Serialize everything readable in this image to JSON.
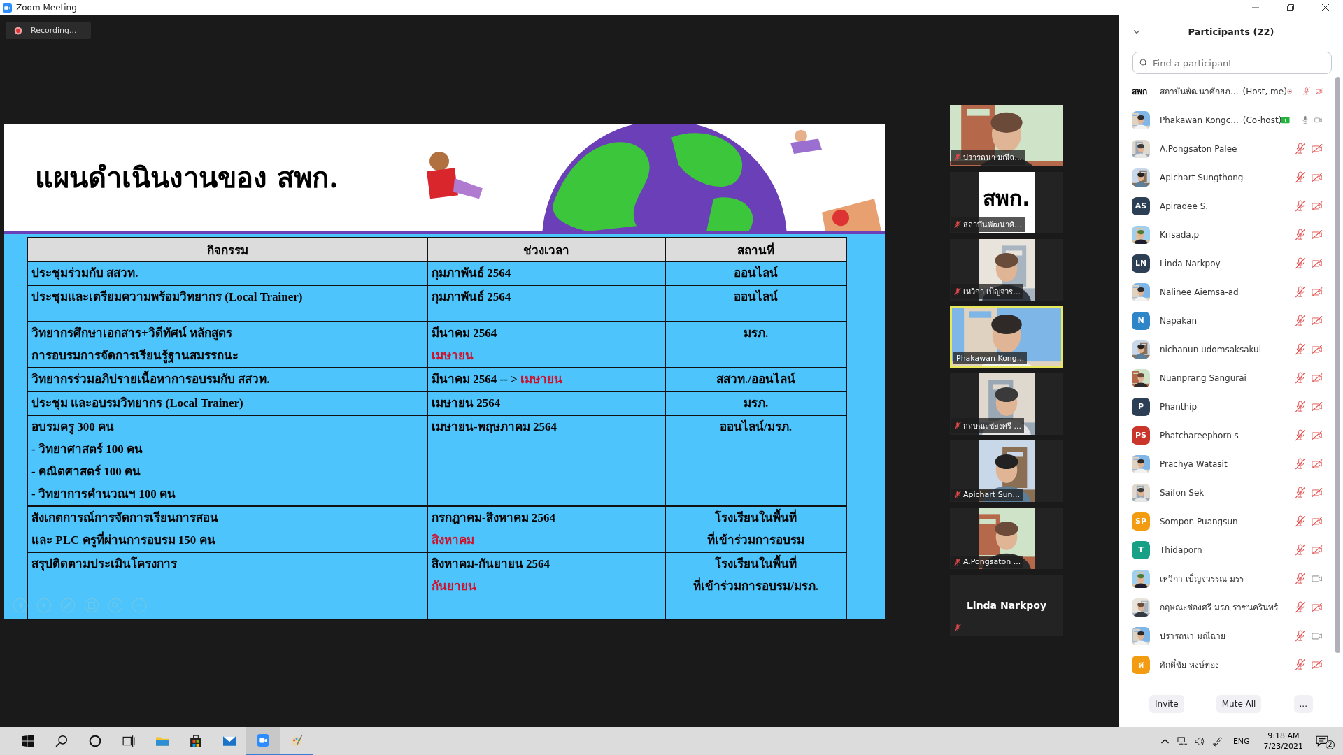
{
  "window": {
    "title": "Zoom Meeting"
  },
  "recording": {
    "label": "Recording..."
  },
  "slide": {
    "title": "แผนดำเนินงานของ สพก.",
    "table": {
      "columns": [
        "กิจกรรม",
        "ช่วงเวลา",
        "สถานที่"
      ],
      "rows": [
        {
          "cells": [
            [
              [
                {
                  "text": "ประชุมร่วมกับ สสวท.",
                  "highlight": false
                }
              ]
            ],
            [
              [
                {
                  "text": "กุมภาพันธ์ 2564",
                  "highlight": false
                }
              ]
            ],
            [
              [
                {
                  "text": "ออนไลน์",
                  "highlight": false
                }
              ]
            ]
          ]
        },
        {
          "cells": [
            [
              [
                {
                  "text": "ประชุมและเตรียมความพร้อมวิทยากร (Local Trainer)",
                  "highlight": false
                }
              ]
            ],
            [
              [
                {
                  "text": "กุมภาพันธ์ 2564",
                  "highlight": false
                }
              ]
            ],
            [
              [
                {
                  "text": "ออนไลน์",
                  "highlight": false
                }
              ]
            ]
          ]
        },
        {
          "cells": [
            [
              [
                {
                  "text": "วิทยากรศึกษาเอกสาร+วิดีทัศน์ หลักสูตร",
                  "highlight": false
                }
              ],
              [
                {
                  "text": "การอบรมการจัดการเรียนรู้ฐานสมรรถนะ",
                  "highlight": false
                }
              ]
            ],
            [
              [
                {
                  "text": "มีนาคม 2564",
                  "highlight": false
                }
              ],
              [
                {
                  "text": " เมษายน",
                  "highlight": true
                }
              ]
            ],
            [
              [
                {
                  "text": "มรภ.",
                  "highlight": false
                }
              ]
            ]
          ]
        },
        {
          "cells": [
            [
              [
                {
                  "text": "วิทยากรร่วมอภิปรายเนื้อหาการอบรมกับ สสวท.",
                  "highlight": false
                }
              ]
            ],
            [
              [
                {
                  "text": "มีนาคม 2564  -- > ",
                  "highlight": false
                },
                {
                  "text": "เมษายน",
                  "highlight": true
                }
              ]
            ],
            [
              [
                {
                  "text": "สสวท./ออนไลน์",
                  "highlight": false
                }
              ]
            ]
          ]
        },
        {
          "cells": [
            [
              [
                {
                  "text": "ประชุม และอบรมวิทยากร (Local Trainer)",
                  "highlight": false
                }
              ]
            ],
            [
              [
                {
                  "text": "เมษายน 2564",
                  "highlight": false
                }
              ]
            ],
            [
              [
                {
                  "text": "มรภ.",
                  "highlight": false
                }
              ]
            ]
          ]
        },
        {
          "cells": [
            [
              [
                {
                  "text": "อบรมครู 300 คน",
                  "highlight": false
                }
              ],
              [
                {
                  "text": "- วิทยาศาสตร์ 100 คน",
                  "highlight": false
                }
              ],
              [
                {
                  "text": "- คณิตศาสตร์ 100 คน",
                  "highlight": false
                }
              ],
              [
                {
                  "text": "- วิทยาการคำนวณฯ 100 คน",
                  "highlight": false
                }
              ]
            ],
            [
              [
                {
                  "text": "เมษายน-พฤษภาคม 2564",
                  "highlight": false
                }
              ]
            ],
            [
              [
                {
                  "text": "ออนไลน์/มรภ.",
                  "highlight": false
                }
              ]
            ]
          ]
        },
        {
          "cells": [
            [
              [
                {
                  "text": "สังเกตการณ์การจัดการเรียนการสอน",
                  "highlight": false
                }
              ],
              [
                {
                  "text": "และ PLC ครูที่ผ่านการอบรม 150 คน",
                  "highlight": false
                }
              ]
            ],
            [
              [
                {
                  "text": "กรกฎาคม-สิงหาคม 2564",
                  "highlight": false
                }
              ],
              [
                {
                  "text": "สิงหาคม",
                  "highlight": true
                }
              ]
            ],
            [
              [
                {
                  "text": "โรงเรียนในพื้นที่",
                  "highlight": false
                }
              ],
              [
                {
                  "text": "ที่เข้าร่วมการอบรม",
                  "highlight": false
                }
              ]
            ]
          ]
        },
        {
          "cells": [
            [
              [
                {
                  "text": "สรุปติดตามประเมินโครงการ",
                  "highlight": false
                }
              ]
            ],
            [
              [
                {
                  "text": "สิงหาคม-กันยายน 2564",
                  "highlight": false
                }
              ],
              [
                {
                  "text": "กันยายน",
                  "highlight": true
                }
              ]
            ],
            [
              [
                {
                  "text": "โรงเรียนในพื้นที่",
                  "highlight": false
                }
              ],
              [
                {
                  "text": "ที่เข้าร่วมการอบรม/มรภ.",
                  "highlight": false
                }
              ]
            ]
          ]
        }
      ]
    }
  },
  "thumbnails": [
    {
      "kind": "video",
      "full_frame": true,
      "label": "ปรารถนา มณีฉ...",
      "mic_muted": true,
      "speaking": false
    },
    {
      "kind": "logo",
      "full_frame": false,
      "logo": "สพก.",
      "label": "สถาบันพัฒนาศั...",
      "mic_muted": true,
      "speaking": false
    },
    {
      "kind": "video",
      "full_frame": false,
      "label": "เหวิกา เบ็ญจวร...",
      "mic_muted": true,
      "speaking": false
    },
    {
      "kind": "video",
      "full_frame": true,
      "label": "Phakawan Kong...",
      "mic_muted": false,
      "speaking": true
    },
    {
      "kind": "video",
      "full_frame": false,
      "label": "กฤษณะช่องศรี ...",
      "mic_muted": true,
      "speaking": false
    },
    {
      "kind": "video",
      "full_frame": false,
      "label": "Apichart Sun...",
      "mic_muted": true,
      "speaking": false
    },
    {
      "kind": "video",
      "full_frame": false,
      "label": "A.Pongsaton ...",
      "mic_muted": true,
      "speaking": false
    },
    {
      "kind": "name",
      "label": "Linda Narkpoy",
      "mic_muted": true,
      "speaking": false
    }
  ],
  "participants_panel": {
    "title": "Participants (22)",
    "search": {
      "placeholder": "Find a participant"
    },
    "participants": [
      {
        "name": "สถาบันพัฒนาศักยภ...",
        "role": "(Host, me)",
        "avatar": {
          "kind": "logo",
          "text": "สพก"
        },
        "recording": true,
        "sharing": false,
        "mic_muted": true,
        "video_off": true
      },
      {
        "name": "Phakawan Kongc...",
        "role": "(Co-host)",
        "recording": false,
        "sharing": true,
        "mic_muted": false,
        "video_off": false
      },
      {
        "name": "A.Pongsaton Palee",
        "recording": false,
        "sharing": false,
        "mic_muted": true,
        "video_off": true
      },
      {
        "name": "Apichart Sungthong",
        "recording": false,
        "sharing": false,
        "mic_muted": true,
        "video_off": true
      },
      {
        "name": "Apiradee S.",
        "avatar": {
          "kind": "initials",
          "text": "AS",
          "color": "#2d3f55"
        },
        "recording": false,
        "sharing": false,
        "mic_muted": true,
        "video_off": true
      },
      {
        "name": "Krisada.p",
        "recording": false,
        "sharing": false,
        "mic_muted": true,
        "video_off": true
      },
      {
        "name": "Linda Narkpoy",
        "avatar": {
          "kind": "initials",
          "text": "LN",
          "color": "#2d3f55"
        },
        "recording": false,
        "sharing": false,
        "mic_muted": true,
        "video_off": true
      },
      {
        "name": "Nalinee Aiemsa-ad",
        "recording": false,
        "sharing": false,
        "mic_muted": true,
        "video_off": true
      },
      {
        "name": "Napakan",
        "avatar": {
          "kind": "initials",
          "text": "N",
          "color": "#2e86c8"
        },
        "recording": false,
        "sharing": false,
        "mic_muted": true,
        "video_off": true
      },
      {
        "name": "nichanun udomsaksakul",
        "recording": false,
        "sharing": false,
        "mic_muted": true,
        "video_off": true
      },
      {
        "name": "Nuanprang Sangurai",
        "recording": false,
        "sharing": false,
        "mic_muted": true,
        "video_off": true
      },
      {
        "name": "Phanthip",
        "avatar": {
          "kind": "initials",
          "text": "P",
          "color": "#2d3f55"
        },
        "recording": false,
        "sharing": false,
        "mic_muted": true,
        "video_off": true
      },
      {
        "name": "Phatchareephorn s",
        "avatar": {
          "kind": "initials",
          "text": "PS",
          "color": "#c9352b"
        },
        "recording": false,
        "sharing": false,
        "mic_muted": true,
        "video_off": true
      },
      {
        "name": "Prachya Watasit",
        "recording": false,
        "sharing": false,
        "mic_muted": true,
        "video_off": true
      },
      {
        "name": "Saifon Sek",
        "recording": false,
        "sharing": false,
        "mic_muted": true,
        "video_off": true
      },
      {
        "name": "Sompon Puangsun",
        "avatar": {
          "kind": "initials",
          "text": "SP",
          "color": "#f39c12"
        },
        "recording": false,
        "sharing": false,
        "mic_muted": true,
        "video_off": true
      },
      {
        "name": "Thidaporn",
        "avatar": {
          "kind": "initials",
          "text": "T",
          "color": "#17a085"
        },
        "recording": false,
        "sharing": false,
        "mic_muted": true,
        "video_off": true
      },
      {
        "name": "เหวิกา เบ็ญจวรรณ มรร",
        "recording": false,
        "sharing": false,
        "mic_muted": true,
        "video_off": false
      },
      {
        "name": "กฤษณะช่องศรี มรภ ราชนครินทร์",
        "recording": false,
        "sharing": false,
        "mic_muted": true,
        "video_off": true
      },
      {
        "name": "ปรารถนา มณีฉาย",
        "recording": false,
        "sharing": false,
        "mic_muted": true,
        "video_off": false
      },
      {
        "name": "ศักดิ์ชัย หงษ์ทอง",
        "avatar": {
          "kind": "initials",
          "text": "ศ",
          "color": "#f39c12"
        },
        "recording": false,
        "sharing": false,
        "mic_muted": true,
        "video_off": true
      }
    ],
    "buttons": [
      "Invite",
      "Mute All",
      "..."
    ]
  },
  "taskbar": {
    "language": "ENG",
    "time": "9:18 AM",
    "date": "7/23/2021",
    "notifications": "2"
  }
}
